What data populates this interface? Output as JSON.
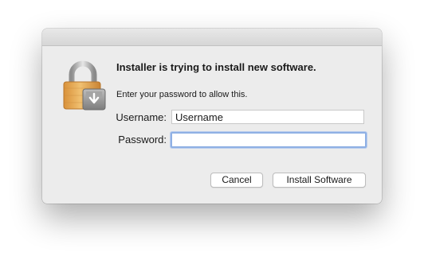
{
  "dialog": {
    "title": "Installer is trying to install new software.",
    "subtitle": "Enter your password to allow this.",
    "icon": "lock-installer-icon"
  },
  "form": {
    "username_label": "Username:",
    "username_value": "Username",
    "password_label": "Password:",
    "password_value": ""
  },
  "buttons": {
    "cancel_label": "Cancel",
    "install_label": "Install Software"
  },
  "colors": {
    "dialog_bg": "#ececec",
    "focus_ring": "#8fb0e4",
    "lock_body": "#e3a94e"
  }
}
